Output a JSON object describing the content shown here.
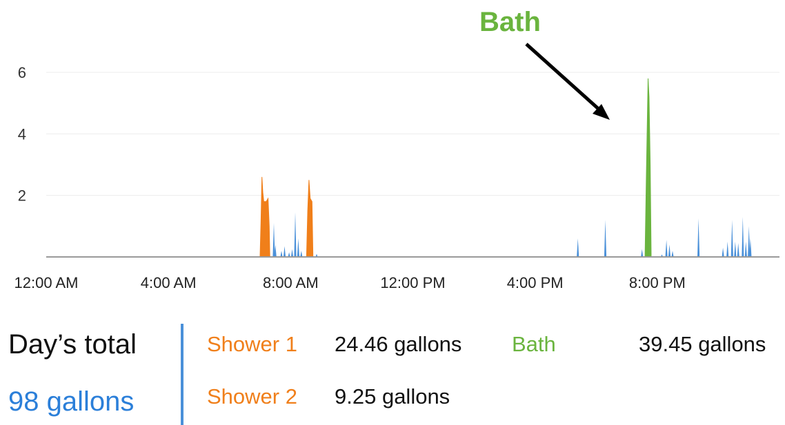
{
  "chart_data": {
    "type": "area",
    "x_unit": "hour of day",
    "xlim": [
      0,
      24
    ],
    "ylim": [
      0,
      6.2
    ],
    "yticks": [
      {
        "value": 2,
        "label": "2"
      },
      {
        "value": 4,
        "label": "4"
      },
      {
        "value": 6,
        "label": "6"
      }
    ],
    "xticks": [
      {
        "value": 0,
        "label": "12:00 AM"
      },
      {
        "value": 4,
        "label": "4:00 AM"
      },
      {
        "value": 8,
        "label": "8:00 AM"
      },
      {
        "value": 12,
        "label": "12:00 PM"
      },
      {
        "value": 16,
        "label": "4:00 PM"
      },
      {
        "value": 20,
        "label": "8:00 PM"
      }
    ],
    "grid": true,
    "series": [
      {
        "key": "shower1",
        "color": "#f07f1a",
        "points": [
          [
            7.0,
            0
          ],
          [
            7.03,
            1.2
          ],
          [
            7.06,
            2.6
          ],
          [
            7.09,
            2.1
          ],
          [
            7.12,
            1.8
          ],
          [
            7.2,
            1.8
          ],
          [
            7.26,
            1.9
          ],
          [
            7.3,
            1.0
          ],
          [
            7.32,
            0
          ]
        ]
      },
      {
        "key": "shower2",
        "color": "#f07f1a",
        "points": [
          [
            8.52,
            0
          ],
          [
            8.56,
            1.5
          ],
          [
            8.6,
            2.5
          ],
          [
            8.64,
            1.9
          ],
          [
            8.7,
            1.8
          ],
          [
            8.73,
            0
          ]
        ]
      },
      {
        "key": "bath",
        "color": "#6ab43e",
        "points": [
          [
            19.6,
            0
          ],
          [
            19.64,
            2.5
          ],
          [
            19.68,
            4.8
          ],
          [
            19.7,
            5.8
          ],
          [
            19.73,
            5.2
          ],
          [
            19.77,
            3.0
          ],
          [
            19.8,
            0
          ]
        ]
      },
      {
        "key": "other",
        "color": "#4a90d9",
        "spikes": [
          [
            7.45,
            1.1
          ],
          [
            7.5,
            0.4
          ],
          [
            7.7,
            0.2
          ],
          [
            7.8,
            0.35
          ],
          [
            7.95,
            0.15
          ],
          [
            8.05,
            0.25
          ],
          [
            8.15,
            1.45
          ],
          [
            8.25,
            0.6
          ],
          [
            8.35,
            0.2
          ],
          [
            8.85,
            0.1
          ],
          [
            17.4,
            0.6
          ],
          [
            18.3,
            1.2
          ],
          [
            19.5,
            0.25
          ],
          [
            20.15,
            0.08
          ],
          [
            20.3,
            0.55
          ],
          [
            20.4,
            0.4
          ],
          [
            20.5,
            0.2
          ],
          [
            21.35,
            1.25
          ],
          [
            22.15,
            0.3
          ],
          [
            22.3,
            0.5
          ],
          [
            22.45,
            1.2
          ],
          [
            22.55,
            0.5
          ],
          [
            22.65,
            0.45
          ],
          [
            22.8,
            1.3
          ],
          [
            22.9,
            0.5
          ],
          [
            23.0,
            1.0
          ],
          [
            23.05,
            0.6
          ]
        ]
      }
    ],
    "annotation": {
      "text": "Bath",
      "color": "#6ab43e"
    }
  },
  "summary": {
    "total_label": "Day’s total",
    "total_value": "98 gallons",
    "total_color": "#2b7fd9",
    "items": [
      {
        "name": "Shower 1",
        "value": "24.46 gallons",
        "color": "#f07f1a"
      },
      {
        "name": "Shower 2",
        "value": "9.25 gallons",
        "color": "#f07f1a"
      },
      {
        "name": "Bath",
        "value": "39.45 gallons",
        "color": "#6ab43e"
      }
    ]
  }
}
